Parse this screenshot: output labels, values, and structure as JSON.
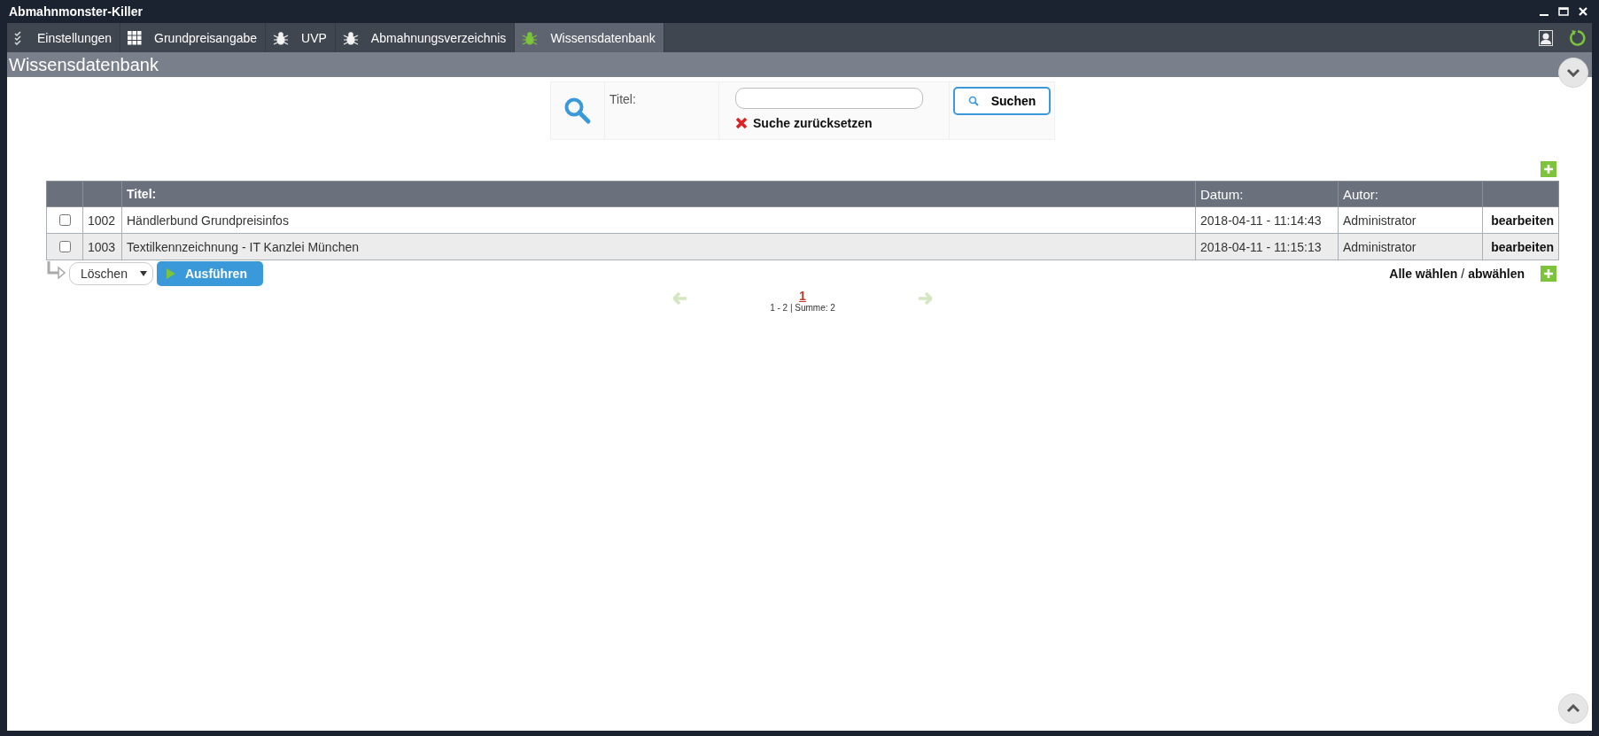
{
  "window": {
    "title": "Abmahnmonster-Killer"
  },
  "tabs": [
    {
      "label": "Einstellungen",
      "kind": "checklist",
      "selected": false
    },
    {
      "label": "Grundpreisangabe",
      "kind": "grid",
      "selected": false
    },
    {
      "label": "UVP",
      "kind": "bug",
      "selected": false
    },
    {
      "label": "Abmahnungsverzeichnis",
      "kind": "bug",
      "selected": false
    },
    {
      "label": "Wissensdatenbank",
      "kind": "bug",
      "selected": true
    }
  ],
  "page_title": "Wissensdatenbank",
  "search": {
    "label": "Titel:",
    "button": "Suchen",
    "reset": "Suche zurücksetzen"
  },
  "table": {
    "columns": [
      "Titel:",
      "Datum:",
      "Autor:"
    ],
    "rows": [
      {
        "checked": false,
        "id": "1002",
        "title": "Händlerbund Grundpreisinfos",
        "date": "2018-04-11 - 11:14:43",
        "author": "Administrator",
        "action": "bearbeiten"
      },
      {
        "checked": false,
        "id": "1003",
        "title": "Textilkennzeichnung - IT Kanzlei München",
        "date": "2018-04-11 - 11:15:13",
        "author": "Administrator",
        "action": "bearbeiten"
      }
    ]
  },
  "bulk": {
    "action": "Löschen",
    "button": "Ausführen",
    "select_all": "Alle wählen",
    "separator": "/",
    "deselect_all": "abwählen"
  },
  "pagination": {
    "current": "1",
    "summary": "1 - 2 | Summe: 2"
  }
}
